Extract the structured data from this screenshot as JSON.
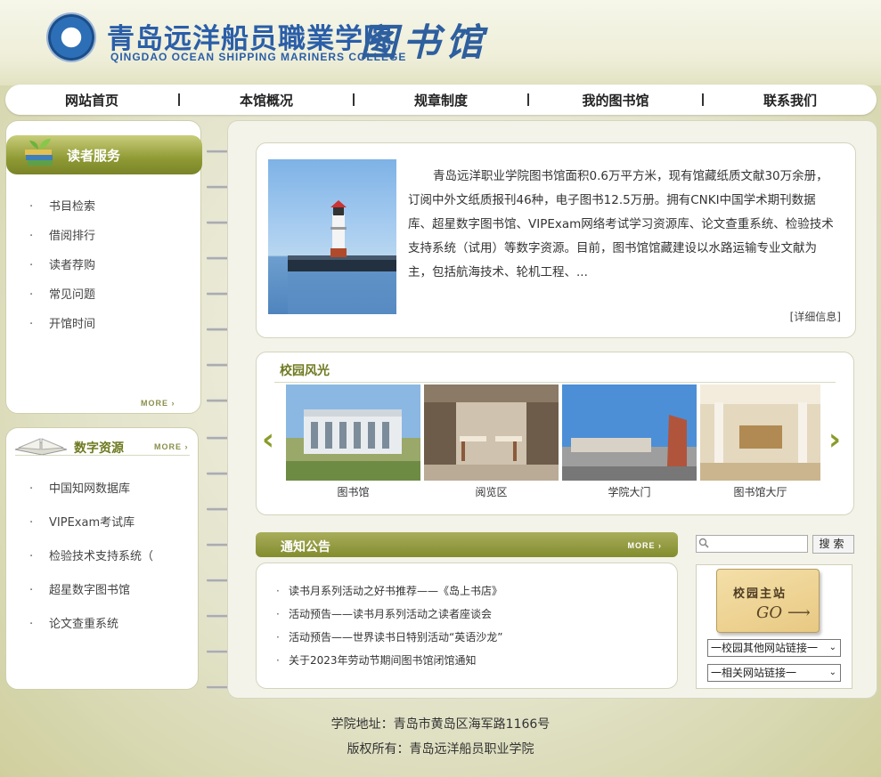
{
  "header": {
    "college_cn": "青岛远洋船员職業学院",
    "college_en": "QINGDAO OCEAN SHIPPING MARINERS COLLEGE",
    "library_title": "图书馆"
  },
  "nav": {
    "items": [
      "网站首页",
      "本馆概况",
      "规章制度",
      "我的图书馆",
      "联系我们"
    ]
  },
  "reader_services": {
    "title": "读者服务",
    "items": [
      "书目检索",
      "借阅排行",
      "读者荐购",
      "常见问题",
      "开馆时间"
    ],
    "more": "MORE"
  },
  "digital_resources": {
    "title": "数字资源",
    "more": "MORE",
    "items": [
      "中国知网数据库",
      "VIPExam考试库",
      "检验技术支持系统（",
      "超星数字图书馆",
      "论文查重系统"
    ]
  },
  "intro": {
    "text": "青岛远洋职业学院图书馆面积0.6万平方米，现有馆藏纸质文献30万余册，订阅中外文纸质报刊46种，电子图书12.5万册。拥有CNKI中国学术期刊数据库、超星数字图书馆、VIPExam网络考试学习资源库、论文查重系统、检验技术支持系统（试用）等数字资源。目前，图书馆馆藏建设以水路运输专业文献为主，包括航海技术、轮机工程、...",
    "detail": "[详细信息]"
  },
  "campus": {
    "title": "校园风光",
    "photos": [
      "图书馆",
      "阅览区",
      "学院大门",
      "图书馆大厅"
    ]
  },
  "notices": {
    "title": "通知公告",
    "more": "MORE",
    "items": [
      "读书月系列活动之好书推荐——《岛上书店》",
      "活动预告——读书月系列活动之读者座谈会",
      "活动预告——世界读书日特别活动“英语沙龙”",
      "关于2023年劳动节期间图书馆闭馆通知"
    ]
  },
  "search": {
    "placeholder": "",
    "button": "搜索"
  },
  "links": {
    "card_text": "校园主站",
    "card_go": "GO",
    "select1": "一校园其他网站链接一",
    "select2": "一相关网站链接一"
  },
  "footer": {
    "address": "学院地址：青岛市黄岛区海军路1166号",
    "copyright": "版权所有：青岛远洋船员职业学院"
  },
  "colors": {
    "accent_green": "#8f9a34",
    "brand_blue": "#2a5ea8"
  }
}
